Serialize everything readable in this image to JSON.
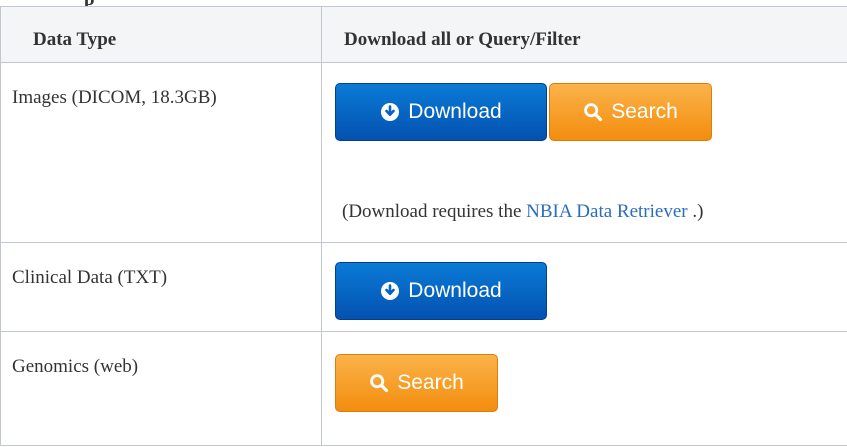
{
  "page_heading_fragment": "p",
  "table": {
    "headers": [
      "Data Type",
      "Download all or Query/Filter"
    ],
    "rows": [
      {
        "label": "Images (DICOM, 18.3GB)",
        "download_label": "Download",
        "search_label": "Search",
        "note_prefix": "(Download requires the ",
        "note_link": "NBIA Data Retriever",
        "note_suffix": " .)"
      },
      {
        "label": "Clinical Data (TXT)",
        "download_label": "Download"
      },
      {
        "label": "Genomics (web)",
        "search_label": "Search"
      }
    ]
  },
  "icons": {
    "download": "circle-down-arrow-icon",
    "search": "magnifier-icon"
  },
  "colors": {
    "download_button": "#0562c2",
    "search_button": "#f5a025",
    "link": "#2a6cbf",
    "header_bg": "#f4f5f7",
    "border": "#c1c7d0"
  }
}
